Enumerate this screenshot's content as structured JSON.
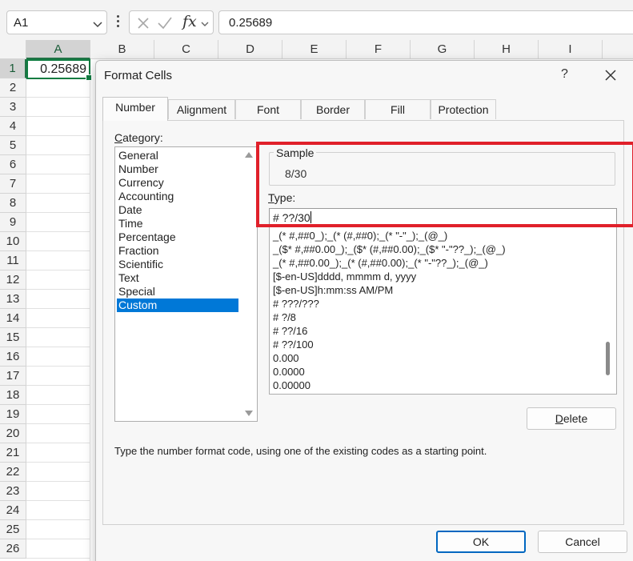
{
  "formula_bar": {
    "name_box": "A1",
    "fx_label": "fx",
    "formula_value": "0.25689"
  },
  "grid": {
    "columns": [
      "A",
      "B",
      "C",
      "D",
      "E",
      "F",
      "G",
      "H",
      "I"
    ],
    "rows": [
      "1",
      "2",
      "3",
      "4",
      "5",
      "6",
      "7",
      "8",
      "9",
      "10",
      "11",
      "12",
      "13",
      "14",
      "15",
      "16",
      "17",
      "18",
      "19",
      "20",
      "21",
      "22",
      "23",
      "24",
      "25",
      "26"
    ],
    "cell_a1": "0.25689",
    "selection_color": "#217346"
  },
  "dialog": {
    "title": "Format Cells",
    "help": "?",
    "tabs": [
      "Number",
      "Alignment",
      "Font",
      "Border",
      "Fill",
      "Protection"
    ],
    "active_tab": "Number",
    "category_label_key": "C",
    "category_label_rest": "ategory:",
    "categories": [
      "General",
      "Number",
      "Currency",
      "Accounting",
      "Date",
      "Time",
      "Percentage",
      "Fraction",
      "Scientific",
      "Text",
      "Special",
      "Custom"
    ],
    "selected_category": "Custom",
    "sample_label": "Sample",
    "sample_value": "8/30",
    "type_label_key": "T",
    "type_label_rest": "ype:",
    "type_value": "# ??/30",
    "format_codes": [
      "_(* #,##0_);_(* (#,##0);_(* \"-\"_);_(@_)",
      "_($* #,##0.00_);_($* (#,##0.00);_($* \"-\"??_);_(@_)",
      "_(* #,##0.00_);_(* (#,##0.00);_(* \"-\"??_);_(@_)",
      "[$-en-US]dddd, mmmm d, yyyy",
      "[$-en-US]h:mm:ss AM/PM",
      "# ???/???",
      "# ?/8",
      "# ??/16",
      "# ??/100",
      "0.000",
      "0.0000",
      "0.00000"
    ],
    "delete_key": "D",
    "delete_rest": "elete",
    "description": "Type the number format code, using one of the existing codes as a starting point.",
    "ok_label": "OK",
    "cancel_label": "Cancel",
    "highlight_color": "#e0202a",
    "accent_color": "#0078d7"
  }
}
